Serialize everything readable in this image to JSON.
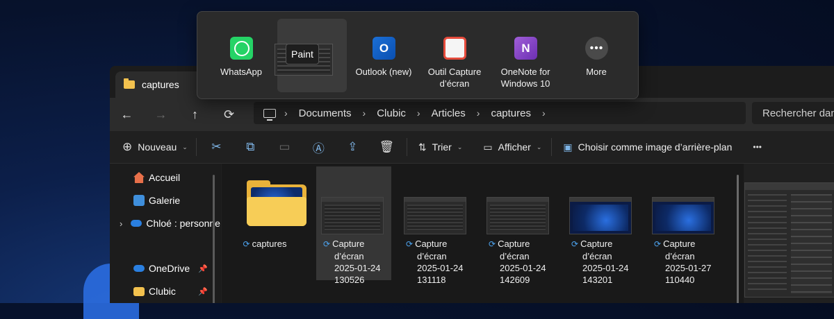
{
  "share": {
    "apps": [
      {
        "name": "WhatsApp",
        "icon": "whatsapp-icon"
      },
      {
        "name": "Paint",
        "icon": "paint-icon"
      },
      {
        "name": "Outlook (new)",
        "icon": "outlook-icon"
      },
      {
        "name": "Outil Capture d’écran",
        "icon": "snipping-tool-icon"
      },
      {
        "name": "OneNote for Windows 10",
        "icon": "onenote-icon"
      },
      {
        "name": "More",
        "icon": "more-icon"
      }
    ],
    "tooltip": "Paint"
  },
  "explorer": {
    "tab_title": "captures",
    "nav": {
      "back": "←",
      "forward": "→",
      "up": "↑",
      "refresh": "⟳"
    },
    "breadcrumb": [
      "Documents",
      "Clubic",
      "Articles",
      "captures"
    ],
    "search_placeholder": "Rechercher dans",
    "toolbar": {
      "new_label": "Nouveau",
      "sort_label": "Trier",
      "view_label": "Afficher",
      "wallpaper_label": "Choisir comme image d’arrière-plan",
      "more": "•••"
    },
    "sidebar": [
      {
        "label": "Accueil",
        "icon": "home-icon",
        "color": "#e8704a"
      },
      {
        "label": "Galerie",
        "icon": "gallery-icon",
        "color": "#3f8fdc"
      },
      {
        "label": "Chloé : personne",
        "icon": "onedrive-icon",
        "color": "#2a7fe0"
      },
      {
        "label": "OneDrive",
        "icon": "onedrive-icon",
        "color": "#2a7fe0"
      },
      {
        "label": "Clubic",
        "icon": "folder-icon",
        "color": "#f2c14e"
      }
    ],
    "files": [
      {
        "line1": "captures",
        "line2": "",
        "line3": ""
      },
      {
        "line1": "Capture",
        "line2": "d’écran",
        "line3": "2025-01-24",
        "line4": "130526"
      },
      {
        "line1": "Capture",
        "line2": "d’écran",
        "line3": "2025-01-24",
        "line4": "131118"
      },
      {
        "line1": "Capture",
        "line2": "d’écran",
        "line3": "2025-01-24",
        "line4": "142609"
      },
      {
        "line1": "Capture",
        "line2": "d’écran",
        "line3": "2025-01-24",
        "line4": "143201"
      },
      {
        "line1": "Capture",
        "line2": "d’écran",
        "line3": "2025-01-27",
        "line4": "110440"
      }
    ]
  }
}
